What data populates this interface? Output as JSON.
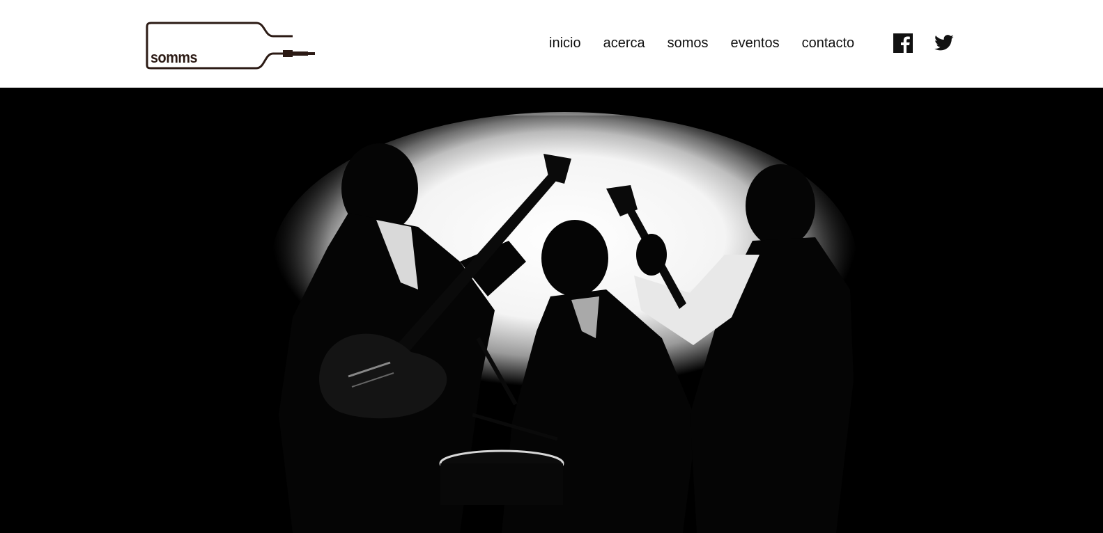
{
  "brand": {
    "logo_text": "somms",
    "logo_color": "#2b1a14"
  },
  "nav": {
    "items": [
      {
        "label": "inicio"
      },
      {
        "label": "acerca"
      },
      {
        "label": "somos"
      },
      {
        "label": "eventos"
      },
      {
        "label": "contacto"
      }
    ]
  },
  "social": {
    "facebook_icon": "facebook-icon",
    "twitter_icon": "twitter-icon"
  },
  "hero": {
    "image": "band-silhouette-photo",
    "background_color": "#000000",
    "spotlight_color": "#ffffff"
  }
}
